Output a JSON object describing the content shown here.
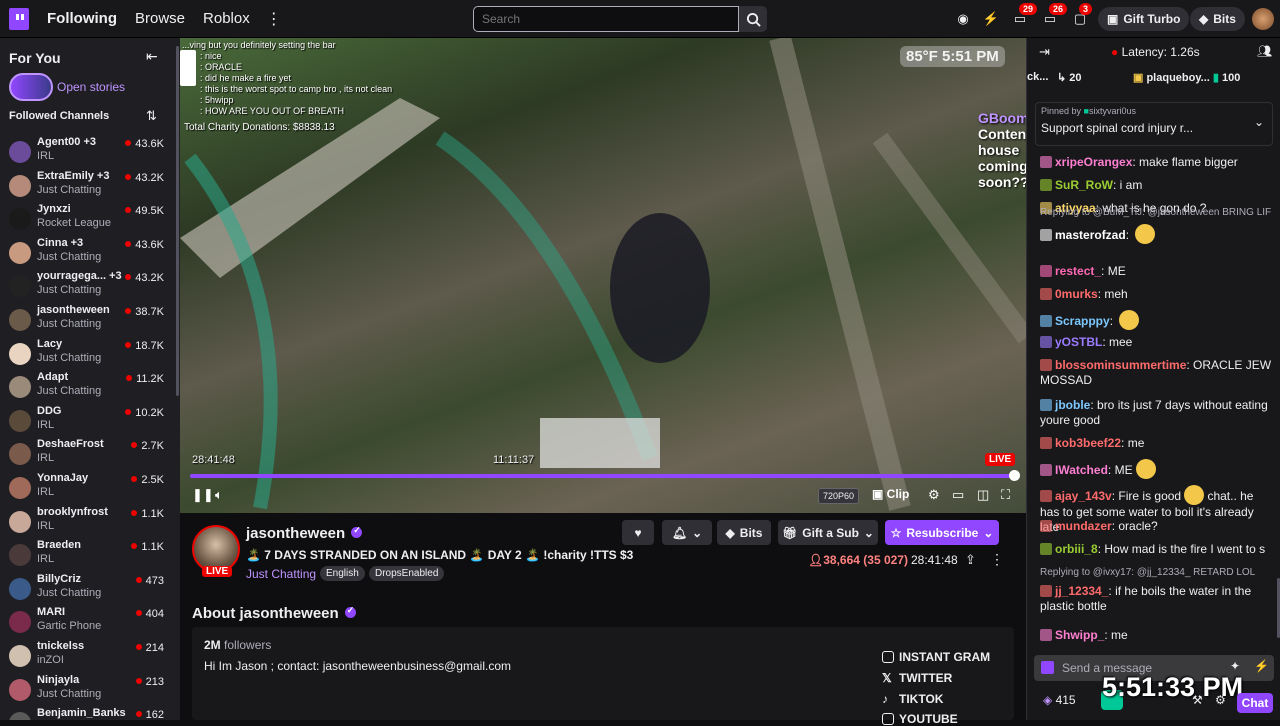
{
  "nav": {
    "links": [
      "Following",
      "Browse",
      "Roblox"
    ],
    "search_placeholder": "Search",
    "badges": {
      "notifications": "29",
      "whispers": "26",
      "inbox": "3"
    },
    "gift_turbo": "Gift Turbo",
    "bits": "Bits"
  },
  "sidebar": {
    "for_you": "For You",
    "open_stories": "Open stories",
    "followed_channels": "Followed Channels",
    "channels": [
      {
        "name": "Agent00 +3",
        "category": "IRL",
        "viewers": "43.6K",
        "color": "#6b4c9a"
      },
      {
        "name": "ExtraEmily +3",
        "category": "Just Chatting",
        "viewers": "43.2K",
        "color": "#b58a7a"
      },
      {
        "name": "Jynxzi",
        "category": "Rocket League",
        "viewers": "49.5K",
        "color": "#1a1a1a"
      },
      {
        "name": "Cinna +3",
        "category": "Just Chatting",
        "viewers": "43.6K",
        "color": "#c89a80"
      },
      {
        "name": "yourragega... +3",
        "category": "Just Chatting",
        "viewers": "43.2K",
        "color": "#222"
      },
      {
        "name": "jasontheween",
        "category": "Just Chatting",
        "viewers": "38.7K",
        "color": "#6a5a4a"
      },
      {
        "name": "Lacy",
        "category": "Just Chatting",
        "viewers": "18.7K",
        "color": "#e8d4c0"
      },
      {
        "name": "Adapt",
        "category": "Just Chatting",
        "viewers": "11.2K",
        "color": "#9a8a7a"
      },
      {
        "name": "DDG",
        "category": "IRL",
        "viewers": "10.2K",
        "color": "#5a4a3a"
      },
      {
        "name": "DeshaeFrost",
        "category": "IRL",
        "viewers": "2.7K",
        "color": "#7a5a4a"
      },
      {
        "name": "YonnaJay",
        "category": "IRL",
        "viewers": "2.5K",
        "color": "#a06a5a"
      },
      {
        "name": "brooklynfrost",
        "category": "IRL",
        "viewers": "1.1K",
        "color": "#c8a898"
      },
      {
        "name": "Braeden",
        "category": "IRL",
        "viewers": "1.1K",
        "color": "#4a3a3a"
      },
      {
        "name": "BillyCriz",
        "category": "Just Chatting",
        "viewers": "473",
        "color": "#3a5a8a"
      },
      {
        "name": "MARI",
        "category": "Gartic Phone",
        "viewers": "404",
        "color": "#7a2a4a"
      },
      {
        "name": "tnickelss",
        "category": "inZOI",
        "viewers": "214",
        "color": "#d0c0b0"
      },
      {
        "name": "Ninjayla",
        "category": "Just Chatting",
        "viewers": "213",
        "color": "#b05a6a"
      },
      {
        "name": "Benjamin_Banks",
        "category": "",
        "viewers": "162",
        "color": "#5a5a5a"
      }
    ]
  },
  "video": {
    "overlay_lines": [
      "...ving but you definitely setting the bar",
      ": nice",
      ": ORACLE",
      ": did he make a fire yet",
      ": this is the worst spot to camp bro , its not clean",
      ": 5hwipp",
      ": HOW ARE YOU OUT OF BREATH"
    ],
    "charity": "Total Charity Donations: $8838.13",
    "weather_time": "85°F 5:51 PM",
    "overlay_chat_user": "GBoomBeats:",
    "overlay_chat_msg1": "Content house",
    "overlay_chat_msg2": "coming soon???",
    "time_left": "28:41:48",
    "time_hover": "11:11:37",
    "live_label": "LIVE",
    "quality": "720P60",
    "clip": "Clip",
    "progress": 1.0
  },
  "stream": {
    "name": "jasontheween",
    "live_label": "LIVE",
    "title": "🏝️ 7 DAYS STRANDED ON AN ISLAND 🏝️ DAY 2 🏝️ !charity !TTS $3",
    "category": "Just Chatting",
    "tags": [
      "English",
      "DropsEnabled"
    ],
    "bits": "Bits",
    "gift_sub": "Gift a Sub",
    "resubscribe": "Resubscribe",
    "viewers": "38,664 (35 027)",
    "uptime": "28:41:48",
    "about_title": "About jasontheween",
    "followers_count": "2M",
    "followers_label": "followers",
    "bio": "Hi Im Jason ; contact: jasontheweenbusiness@gmail.com",
    "socials": [
      "INSTANT GRAM",
      "TWITTER",
      "TIKTOK",
      "YOUTUBE"
    ]
  },
  "chat": {
    "stack_label": "ck...",
    "stack_count": "20",
    "latency": "Latency: 1.26s",
    "top_user": "plaqueboy...",
    "top_count": "100",
    "pinned_by": "Pinned by",
    "pinned_user": "sixtyvari0us",
    "pinned_msg": "Support spinal cord injury r...",
    "messages": [
      {
        "user": "xripeOrangex",
        "color": "#ff7fd1",
        "text": "make flame bigger",
        "emote": false
      },
      {
        "user": "SuR_RoW",
        "color": "#9acd32",
        "text": "i am",
        "emote": false
      },
      {
        "user": "atiyyaa",
        "color": "#ffd966",
        "text": "what is he gon do ?",
        "emote": false
      },
      {
        "user": "masterofzad",
        "color": "#ffffff",
        "text": "",
        "emote": true,
        "reply": "Replying to @BuM_TiJ: @jasontheween BRING LIF"
      },
      {
        "user": "restect_",
        "color": "#ff69b4",
        "text": "ME",
        "emote": false
      },
      {
        "user": "0murks",
        "color": "#ff6b6b",
        "text": "meh",
        "emote": false
      },
      {
        "user": "Scrapppy",
        "color": "#7cc8ff",
        "text": "",
        "emote": true
      },
      {
        "user": "yOSTBL",
        "color": "#9b7bff",
        "text": "mee",
        "emote": false
      },
      {
        "user": "blossominsummertime",
        "color": "#ff6b6b",
        "text": "ORACLE JEW MOSSAD",
        "emote": false
      },
      {
        "user": "jboble",
        "color": "#7cc8ff",
        "text": "bro its just 7 days without eating youre good",
        "emote": false
      },
      {
        "user": "kob3beef22",
        "color": "#ff6b6b",
        "text": "me",
        "emote": false
      },
      {
        "user": "IWatched",
        "color": "#ff7fd1",
        "text": "ME",
        "emote": true
      },
      {
        "user": "ajay_143v",
        "color": "#ff6b6b",
        "text": "Fire is good",
        "emote": true,
        "tail": "chat.. he has to get some water to boil it's already late"
      },
      {
        "user": "mundazer",
        "color": "#ff6b6b",
        "text": "oracle?",
        "emote": false
      },
      {
        "user": "orbiii_8",
        "color": "#9acd32",
        "text": "How mad is the fire I went to s",
        "emote": false
      },
      {
        "user": "jj_12334_",
        "color": "#ff6b6b",
        "text": "if he boils the water in the plastic bottle",
        "emote": false,
        "reply": "Replying to @ivxy17: @jj_12334_ RETARD LOL"
      },
      {
        "user": "Shwipp_",
        "color": "#ff7fd1",
        "text": "me",
        "emote": false
      }
    ],
    "input_placeholder": "Send a message",
    "points": "415",
    "clock": "5:51:33 PM",
    "chat_button": "Chat"
  }
}
